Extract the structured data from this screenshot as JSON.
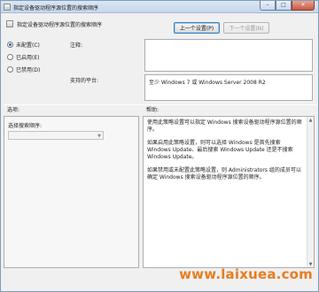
{
  "window": {
    "title": "指定设备驱动程序源位置的搜索顺序",
    "buttons": {
      "minimize": "–",
      "maximize": "□",
      "close": "✕"
    }
  },
  "header": {
    "setting_name": "指定设备驱动程序源位置的搜索顺序",
    "prev_button": "上一个设置(P)",
    "next_button": "下一个设置(N)"
  },
  "state": {
    "options": [
      {
        "label": "未配置(C)",
        "checked": true
      },
      {
        "label": "已启用(E)",
        "checked": false
      },
      {
        "label": "已禁用(D)",
        "checked": false
      }
    ]
  },
  "comment": {
    "label": "注释:",
    "value": ""
  },
  "supported": {
    "label": "支持的平台:",
    "value": "至少 Windows 7 或 Windows Server 2008 R2"
  },
  "options_section": {
    "label": "选项:",
    "search_order_label": "选择搜索顺序:",
    "search_order_value": ""
  },
  "help_section": {
    "label": "帮助:",
    "paragraphs": [
      "使用此策略设置可以指定 Windows 搜索设备驱动程序源位置的顺序。",
      "如果启用此策略设置，则可以选择 Windows 是首先搜索 Windows Update、最后搜索 Windows Update 还是不搜索 Windows Update。",
      "如果禁用或未配置此策略设置，则 Administrators 组的成员可以确定 Windows 搜索设备驱动程序源位置的顺序。"
    ]
  },
  "icons": {
    "title": "policy-icon",
    "header": "policy-icon"
  },
  "watermark": "www.laixuea.com",
  "colors": {
    "accent": "#3c7fb1",
    "watermark": "#e87d1e"
  }
}
